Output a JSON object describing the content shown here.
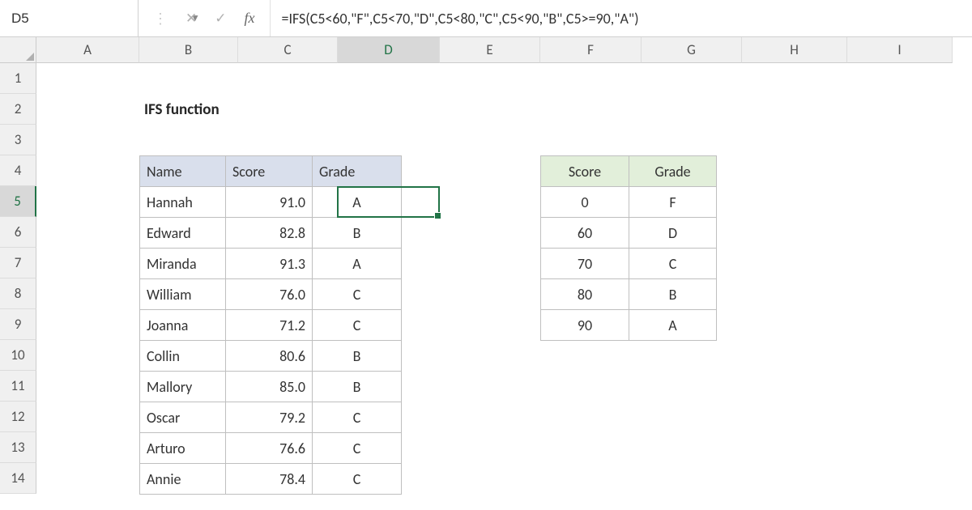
{
  "namebox": "D5",
  "formula": "=IFS(C5<60,\"F\",C5<70,\"D\",C5<80,\"C\",C5<90,\"B\",C5>=90,\"A\")",
  "fx_label": "fx",
  "columns": [
    "A",
    "B",
    "C",
    "D",
    "E",
    "F",
    "G",
    "H",
    "I"
  ],
  "rows": [
    "1",
    "2",
    "3",
    "4",
    "5",
    "6",
    "7",
    "8",
    "9",
    "10",
    "11",
    "12",
    "13",
    "14"
  ],
  "active_col": "D",
  "active_row": "5",
  "title": "IFS function",
  "table1": {
    "headers": {
      "name": "Name",
      "score": "Score",
      "grade": "Grade"
    },
    "rows": [
      {
        "name": "Hannah",
        "score": "91.0",
        "grade": "A"
      },
      {
        "name": "Edward",
        "score": "82.8",
        "grade": "B"
      },
      {
        "name": "Miranda",
        "score": "91.3",
        "grade": "A"
      },
      {
        "name": "William",
        "score": "76.0",
        "grade": "C"
      },
      {
        "name": "Joanna",
        "score": "71.2",
        "grade": "C"
      },
      {
        "name": "Collin",
        "score": "80.6",
        "grade": "B"
      },
      {
        "name": "Mallory",
        "score": "85.0",
        "grade": "B"
      },
      {
        "name": "Oscar",
        "score": "79.2",
        "grade": "C"
      },
      {
        "name": "Arturo",
        "score": "76.6",
        "grade": "C"
      },
      {
        "name": "Annie",
        "score": "78.4",
        "grade": "C"
      }
    ]
  },
  "table2": {
    "headers": {
      "score": "Score",
      "grade": "Grade"
    },
    "rows": [
      {
        "score": "0",
        "grade": "F"
      },
      {
        "score": "60",
        "grade": "D"
      },
      {
        "score": "70",
        "grade": "C"
      },
      {
        "score": "80",
        "grade": "B"
      },
      {
        "score": "90",
        "grade": "A"
      }
    ]
  }
}
